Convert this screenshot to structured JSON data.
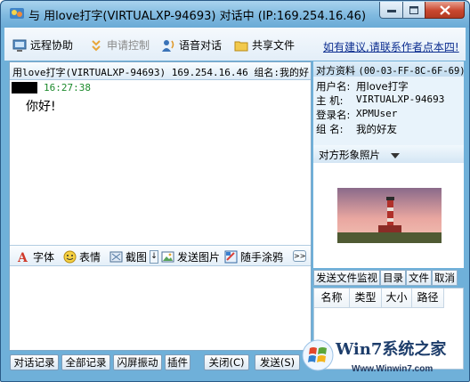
{
  "window": {
    "title": "与 用love打字(VIRTUALXP-94693) 对话中 (IP:169.254.16.46)"
  },
  "toolbar": {
    "remote_assist": "远程协助",
    "request_control": "申请控制",
    "voice_chat": "语音对话",
    "share_files": "共享文件",
    "suggest_link": "如有建议,请联系作者点本四!"
  },
  "chat": {
    "header": "用love打字(VIRTUALXP-94693) 169.254.16.46 组名:我的好",
    "messages": [
      {
        "time": "16:27:38",
        "text": "你好!"
      }
    ]
  },
  "chat_toolbar": {
    "font": "字体",
    "emoji": "表情",
    "screenshot": "截图",
    "send_image": "发送图片",
    "doodle": "随手涂鸦",
    "more": ">>"
  },
  "bottom_buttons": {
    "chat_log": "对话记录",
    "all_logs": "全部记录",
    "shake": "闪屏振动",
    "plugin": "插件",
    "close": "关闭(C)",
    "send": "发送(S)"
  },
  "profile": {
    "header_label": "对方资料",
    "mac": "(00-03-FF-8C-6F-69)",
    "rows": [
      {
        "key": "用户名:",
        "value": "用love打字"
      },
      {
        "key": "主  机:",
        "value": "VIRTUALXP-94693"
      },
      {
        "key": "登录名:",
        "value": "XPMUser"
      },
      {
        "key": "组  名:",
        "value": "我的好友"
      }
    ],
    "photo_label": "对方形象照片"
  },
  "transfer": {
    "tabs": [
      "发送文件监视",
      "目录",
      "文件",
      "取消"
    ],
    "columns": [
      "名称",
      "类型",
      "大小",
      "路径"
    ]
  },
  "watermark": {
    "title": "Win7系统之家",
    "url": "Www.Winwin7.com"
  },
  "colors": {
    "frame": "#6fb0d9",
    "link": "#0b2c8f",
    "time_green": "#1c8a2c"
  }
}
